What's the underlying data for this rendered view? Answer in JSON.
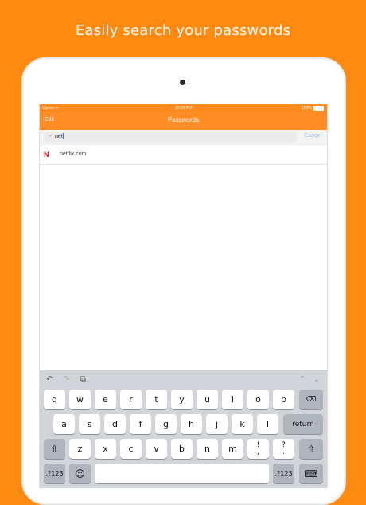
{
  "headline": "Easily search your passwords",
  "status": {
    "carrier": "Carrier ᯤ",
    "time": "10:29 PM",
    "battery": "100%"
  },
  "nav": {
    "edit": "Edit",
    "title": "Passwords"
  },
  "search": {
    "value": "net",
    "cancel": "Cancel",
    "icon": "search-icon"
  },
  "results": [
    {
      "logo": "N",
      "label": "netflix.com"
    }
  ],
  "keyboard": {
    "toolbar": {
      "undo": "↶",
      "redo": "↷",
      "paste": "⧉",
      "up": "⌃",
      "down": "⌄"
    },
    "row1": [
      "q",
      "w",
      "e",
      "r",
      "t",
      "y",
      "u",
      "i",
      "o",
      "p"
    ],
    "backspace": "⌫",
    "row2": [
      "a",
      "s",
      "d",
      "f",
      "g",
      "h",
      "j",
      "k",
      "l"
    ],
    "return": "return",
    "shift": "⇧",
    "row3": [
      "z",
      "x",
      "c",
      "v",
      "b",
      "n",
      "m"
    ],
    "exclaim_top": "!",
    "exclaim_bottom": ",",
    "question_top": "?",
    "question_bottom": ".",
    "numbers": ".?123",
    "emoji": "☺",
    "dismiss": "⌨"
  },
  "colors": {
    "accent": "#ff8a12",
    "keyboard_bg": "#d1d4d9"
  }
}
